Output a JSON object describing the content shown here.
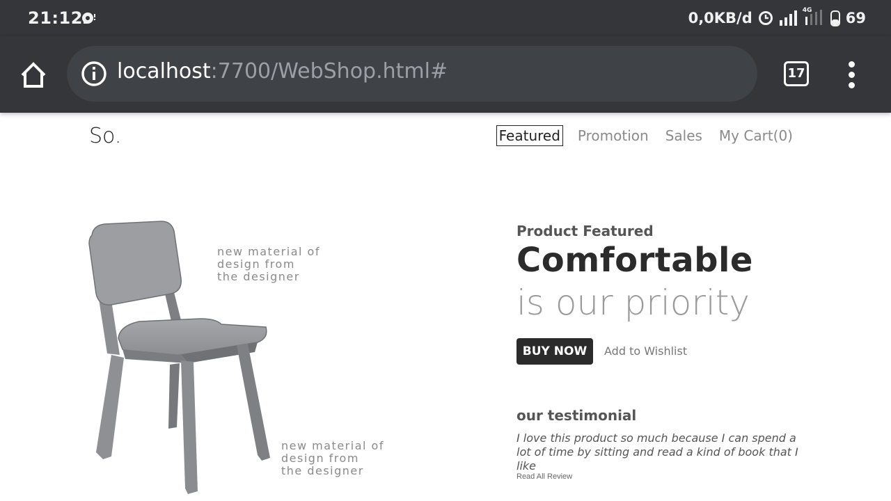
{
  "status_bar": {
    "time": "21:12",
    "data_rate": "0,0KB/d",
    "network_label": "4G",
    "battery_level": "69"
  },
  "browser": {
    "url_host": "localhost",
    "url_rest": ":7700/WebShop.html#",
    "tab_count": "17"
  },
  "site": {
    "logo": "So.",
    "nav": [
      {
        "label": "Featured"
      },
      {
        "label": "Promotion"
      },
      {
        "label": "Sales"
      },
      {
        "label": "My Cart(0)"
      }
    ]
  },
  "product": {
    "captions": [
      {
        "line1": "new material of",
        "line2": "design from",
        "line3": "the designer"
      },
      {
        "line1": "new material of",
        "line2": "design from",
        "line3": "the designer"
      }
    ],
    "section_label": "Product Featured",
    "headline": "Comfortable",
    "subline": "is our priority",
    "buy_label": "BUY NOW",
    "wishlist_label": "Add to Wishlist"
  },
  "testimonial": {
    "title": "our testimonial",
    "text": "I love this product so much because I can spend a lot of time by sitting and read a kind of book that I like",
    "link": "Read All Review"
  }
}
